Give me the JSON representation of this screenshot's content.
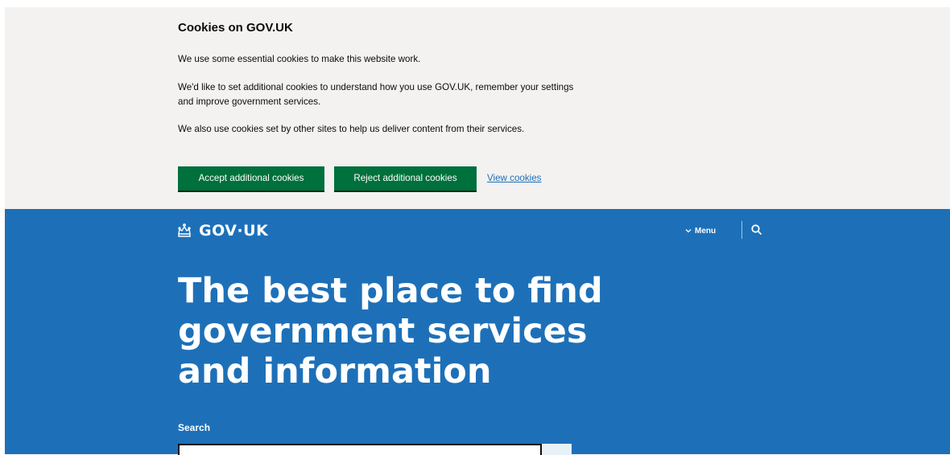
{
  "cookie_banner": {
    "title": "Cookies on GOV.UK",
    "paragraph_1": "We use some essential cookies to make this website work.",
    "paragraph_2": "We'd like to set additional cookies to understand how you use GOV.UK, remember your settings and improve government services.",
    "paragraph_3": "We also use cookies set by other sites to help us deliver content from their services.",
    "accept_label": "Accept additional cookies",
    "reject_label": "Reject additional cookies",
    "view_label": "View cookies"
  },
  "header": {
    "logo_text": "GOV·UK",
    "logo_icon": "crown-icon",
    "menu_label": "Menu",
    "menu_icon": "chevron-down-icon",
    "search_icon": "search-icon"
  },
  "hero": {
    "title_lines": [
      "The best place to find",
      "government services",
      "and information"
    ]
  },
  "search": {
    "label": "Search",
    "placeholder": ""
  },
  "colors": {
    "brand_blue": "#1d70b8",
    "button_green": "#00703c",
    "banner_bg": "#f3f2f1",
    "link": "#1d70b8"
  }
}
